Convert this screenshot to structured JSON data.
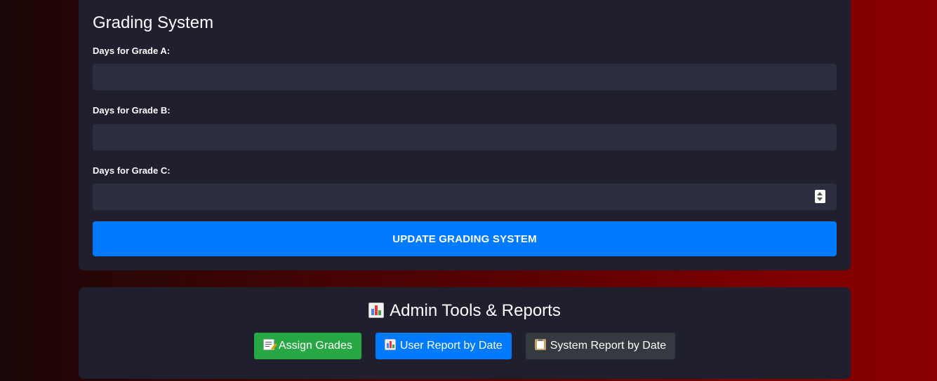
{
  "grading": {
    "title": "Grading System",
    "fields": [
      {
        "label": "Days for Grade A:",
        "value": ""
      },
      {
        "label": "Days for Grade B:",
        "value": ""
      },
      {
        "label": "Days for Grade C:",
        "value": ""
      }
    ],
    "submit_label": "UPDATE GRADING SYSTEM"
  },
  "admin": {
    "title": "Admin Tools & Reports",
    "title_icon": "bar-chart-icon",
    "buttons": [
      {
        "label": "Assign Grades",
        "icon": "memo-icon",
        "color": "#28a745"
      },
      {
        "label": "User Report by Date",
        "icon": "bar-chart-icon",
        "color": "#007bff"
      },
      {
        "label": "System Report by Date",
        "icon": "clipboard-icon",
        "color": "#343a40"
      }
    ]
  },
  "colors": {
    "card_background": "#1f1f2e",
    "input_background": "#2d2d40",
    "primary": "#007bff",
    "success": "#28a745",
    "dark": "#343a40",
    "page_gradient_end": "#8a0000"
  }
}
